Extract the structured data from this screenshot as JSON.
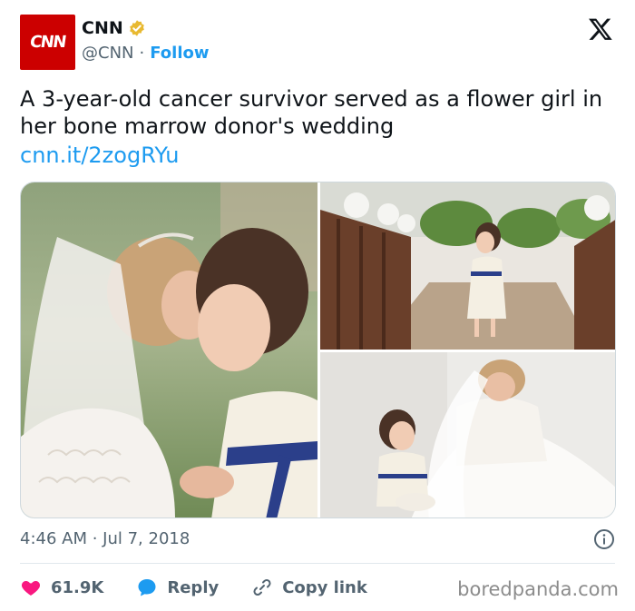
{
  "account": {
    "logo_text": "CNN",
    "name": "CNN",
    "handle": "@CNN",
    "separator": "·",
    "follow_label": "Follow",
    "verified_color": "#e8b931",
    "logo_color": "#cc0000"
  },
  "tweet": {
    "text": "A 3-year-old cancer survivor served as a flower girl in her bone marrow donor's wedding",
    "link": "cnn.it/2zogRYu",
    "timestamp": "4:46 AM · Jul 7, 2018"
  },
  "actions": {
    "likes": "61.9K",
    "reply_label": "Reply",
    "copy_label": "Copy link"
  },
  "icons": [
    "cnn-logo",
    "verified-badge-icon",
    "x-logo-icon",
    "info-icon",
    "heart-icon",
    "reply-bubble-icon",
    "link-icon"
  ],
  "colors": {
    "accent": "#1d9bf0",
    "heart": "#f91880",
    "muted": "#536471"
  },
  "watermark": "boredpanda.com"
}
